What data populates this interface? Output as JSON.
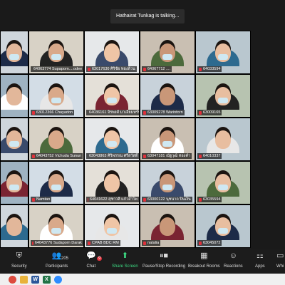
{
  "meeting": {
    "speaking_banner": "Hathairat Tunkag is talking..."
  },
  "participants": [
    {
      "name": "",
      "muted": false
    },
    {
      "name": "64063774 Supaporn....odee",
      "muted": true
    },
    {
      "name": "63017630 ศิริชัย ทองล้วน",
      "muted": true
    },
    {
      "name": "64067712 ....",
      "muted": true
    },
    {
      "name": "64033594",
      "muted": true
    },
    {
      "name": "",
      "muted": false
    },
    {
      "name": "63012366 Chayadon",
      "muted": true
    },
    {
      "name": "64036161 จิรพงศ์ มาเอี่ยมทรัพย์",
      "muted": true
    },
    {
      "name": "63009278 Warintorn",
      "muted": true
    },
    {
      "name": "63009165",
      "muted": true
    },
    {
      "name": "",
      "muted": false
    },
    {
      "name": "64043752 Vichuda Sunun",
      "muted": true
    },
    {
      "name": "63043863 ศิริพรรณ ศรีสวัสดิ์",
      "muted": true
    },
    {
      "name": "63047181 ณัฐวุฒิ ทองคำ",
      "muted": true
    },
    {
      "name": "64010337",
      "muted": true
    },
    {
      "name": "",
      "muted": false
    },
    {
      "name": "Namtan",
      "muted": true
    },
    {
      "name": "64041622 สุชาวลี แก้วอำไพ",
      "muted": true
    },
    {
      "name": "63000122 นุชนาถ ปิ่นเงิน",
      "muted": true
    },
    {
      "name": "63035594",
      "muted": true
    },
    {
      "name": "",
      "muted": false
    },
    {
      "name": "64043776 Sudaporn Darak",
      "muted": true
    },
    {
      "name": "CPAB BDC RM",
      "muted": true
    },
    {
      "name": "natalia",
      "muted": true
    },
    {
      "name": "63045072",
      "muted": true
    }
  ],
  "toolbar": {
    "security": "Security",
    "participants": "Participants",
    "participants_count": "205",
    "chat": "Chat",
    "chat_count": "9",
    "share_screen": "Share Screen",
    "record": "Pause/Stop Recording",
    "breakout": "Breakout Rooms",
    "reactions": "Reactions",
    "apps": "Apps",
    "whiteboard": "Whi"
  },
  "icons": {
    "security": "shield-icon",
    "participants": "people-icon",
    "chat": "chat-icon",
    "share": "share-screen-icon",
    "record": "record-icon",
    "breakout": "breakout-icon",
    "reactions": "smile-icon",
    "apps": "apps-icon"
  },
  "colors": {
    "accent_green": "#3ddc84",
    "mute_red": "#e0303a",
    "taskbar": "#f0f0f0"
  }
}
